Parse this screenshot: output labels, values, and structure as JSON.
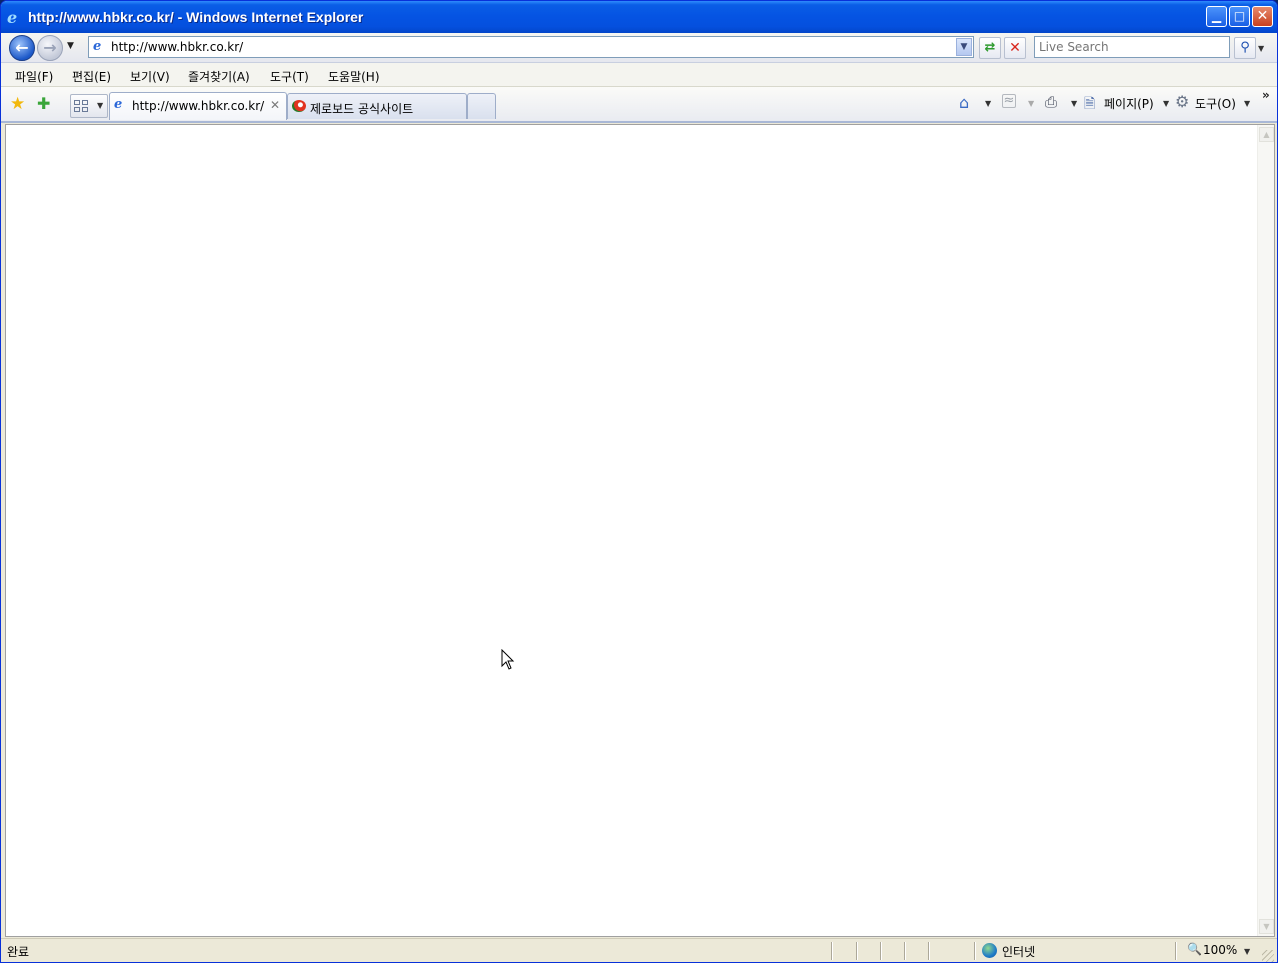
{
  "window": {
    "title": "http://www.hbkr.co.kr/ - Windows Internet Explorer",
    "controls": {
      "minimize": "▁",
      "maximize": "□",
      "close": "✕"
    }
  },
  "address_bar": {
    "url": "http://www.hbkr.co.kr/",
    "icons": [
      "back-icon",
      "forward-icon",
      "ie-page-icon",
      "refresh-icon",
      "stop-icon"
    ]
  },
  "search": {
    "placeholder": "Live Search",
    "go_icon": "search-icon"
  },
  "menu": {
    "items": [
      "파일(F)",
      "편집(E)",
      "보기(V)",
      "즐겨찾기(A)",
      "도구(T)",
      "도움말(H)"
    ]
  },
  "tabs": [
    {
      "label": "http://www.hbkr.co.kr/",
      "active": true
    },
    {
      "label": "제로보드 공식사이트",
      "active": false
    }
  ],
  "command_bar": {
    "page_label": "페이지(P)",
    "tools_label": "도구(O)",
    "more": "»"
  },
  "status_bar": {
    "status": "완료",
    "zone": "인터넷",
    "zoom": "100%"
  },
  "colors": {
    "title_blue": "#0554e3",
    "chrome_bg": "#ece9d8",
    "tab_border": "#9eadc9"
  }
}
